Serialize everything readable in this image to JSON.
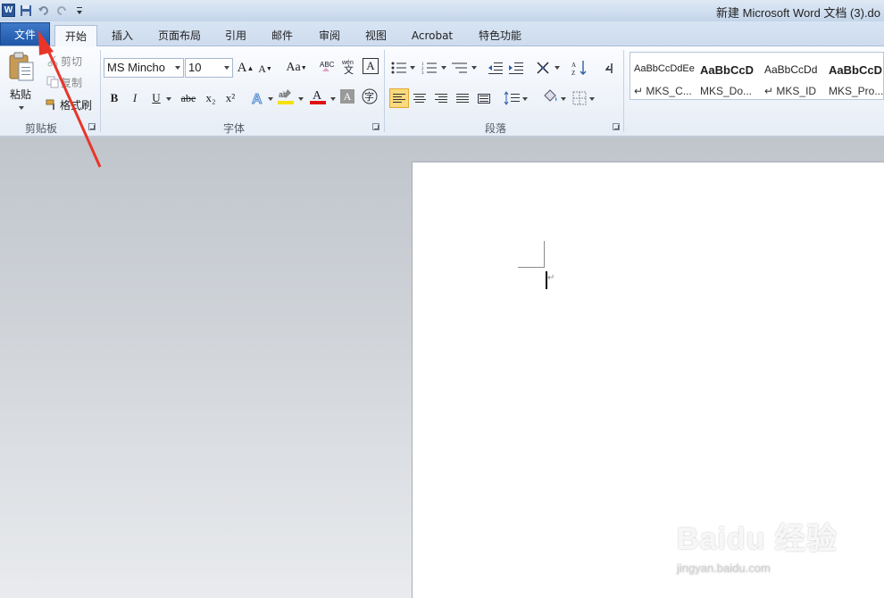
{
  "window": {
    "title": "新建 Microsoft Word 文档 (3).do",
    "app_icon": "word-logo",
    "quick_access": [
      "save-icon",
      "undo-icon",
      "redo-icon",
      "customize-qat-icon"
    ]
  },
  "tabs": [
    {
      "label": "文件",
      "active": false,
      "special": true
    },
    {
      "label": "开始",
      "active": true
    },
    {
      "label": "插入"
    },
    {
      "label": "页面布局"
    },
    {
      "label": "引用"
    },
    {
      "label": "邮件"
    },
    {
      "label": "审阅"
    },
    {
      "label": "视图"
    },
    {
      "label": "Acrobat"
    },
    {
      "label": "特色功能"
    }
  ],
  "ribbon": {
    "clipboard": {
      "label": "剪贴板",
      "paste": "粘贴",
      "cut": "剪切",
      "copy": "复制",
      "format_painter": "格式刷"
    },
    "font": {
      "label": "字体",
      "font_name": "MS Mincho",
      "font_size": "10",
      "bold": "B",
      "italic": "I",
      "underline": "U",
      "strikethrough": "abe",
      "subscript": "x₂",
      "superscript": "x²",
      "grow": "A",
      "shrink": "A",
      "change_case": "Aa",
      "clear_format": "A",
      "phonetic": "wén",
      "char_border": "A",
      "highlight_color": "#f5e100",
      "font_color": "#e01010"
    },
    "paragraph": {
      "label": "段落"
    },
    "styles": {
      "items": [
        {
          "sample": "AaBbCcDdEe",
          "name": "↵ MKS_C..."
        },
        {
          "sample": "AaBbCcD",
          "name": "MKS_Do..."
        },
        {
          "sample": "AaBbCcDd",
          "name": "↵ MKS_ID"
        },
        {
          "sample": "AaBbCcD",
          "name": "MKS_Pro..."
        }
      ]
    }
  },
  "document": {
    "paragraph_mark": "↵"
  },
  "watermark": {
    "brand": "Baidu 经验",
    "url": "jingyan.baidu.com"
  },
  "annotation": {
    "color": "#e8352a"
  }
}
